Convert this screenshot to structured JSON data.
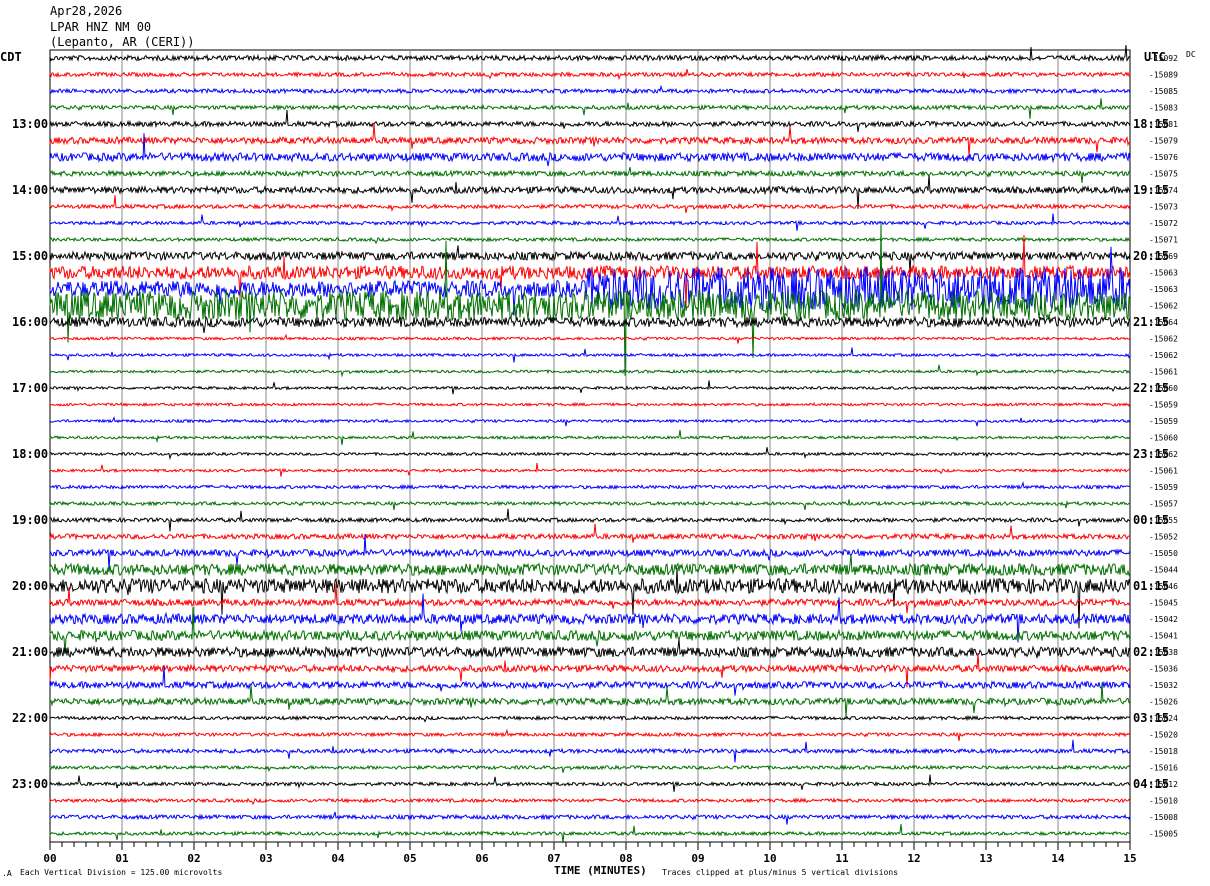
{
  "header": {
    "date": "Apr28,2026",
    "station": "LPAR HNZ NM 00",
    "location": "(Lepanto, AR (CERI))"
  },
  "chart_data": {
    "type": "line",
    "title": "LPAR HNZ NM 00 helicorder",
    "left_zone": "CDT",
    "right_zone": "UTC",
    "dc_header": "DC",
    "xlabel": "TIME (MINUTES)",
    "x_range": [
      0,
      15
    ],
    "x_ticks": [
      "00",
      "01",
      "02",
      "03",
      "04",
      "05",
      "06",
      "07",
      "08",
      "09",
      "10",
      "11",
      "12",
      "13",
      "14",
      "15"
    ],
    "left_hour_labels": [
      "13:00",
      "14:00",
      "15:00",
      "16:00",
      "17:00",
      "18:00",
      "19:00",
      "20:00",
      "21:00",
      "22:00",
      "23:00"
    ],
    "right_hour_labels": [
      "18:15",
      "19:15",
      "20:15",
      "21:15",
      "22:15",
      "23:15",
      "00:15",
      "01:15",
      "02:15",
      "03:15",
      "04:15"
    ],
    "trace_colors": [
      "#000000",
      "#ff0000",
      "#0000ff",
      "#007000"
    ],
    "dc_offsets": [
      -15092,
      -15089,
      -15085,
      -15083,
      -15081,
      -15079,
      -15076,
      -15075,
      -15074,
      -15073,
      -15072,
      -15071,
      -15069,
      -15063,
      -15063,
      -15062,
      -15064,
      -15062,
      -15062,
      -15061,
      -15060,
      -15059,
      -15059,
      -15060,
      -15062,
      -15061,
      -15059,
      -15057,
      -15055,
      -15052,
      -15050,
      -15044,
      -15046,
      -15045,
      -15042,
      -15041,
      -15038,
      -15036,
      -15032,
      -15026,
      -15024,
      -15020,
      -15018,
      -15016,
      -15012,
      -15010,
      -15008,
      -15005
    ],
    "noise_divisions": [
      0.15,
      0.12,
      0.12,
      0.12,
      0.15,
      0.2,
      0.25,
      0.15,
      0.2,
      0.12,
      0.1,
      0.1,
      0.25,
      0.4,
      0.5,
      0.9,
      0.3,
      0.08,
      0.08,
      0.08,
      0.08,
      0.08,
      0.08,
      0.08,
      0.08,
      0.08,
      0.1,
      0.1,
      0.12,
      0.15,
      0.2,
      0.35,
      0.45,
      0.2,
      0.3,
      0.3,
      0.3,
      0.2,
      0.2,
      0.2,
      0.1,
      0.1,
      0.12,
      0.1,
      0.1,
      0.1,
      0.12,
      0.1
    ],
    "vertical_division_uv": 125.0,
    "clip_divisions": 5
  },
  "footer": {
    "scale_text": "Each Vertical Division =  125.00 microvolts",
    "clip_text": "Traces clipped at plus/minus 5 vertical divisions"
  }
}
